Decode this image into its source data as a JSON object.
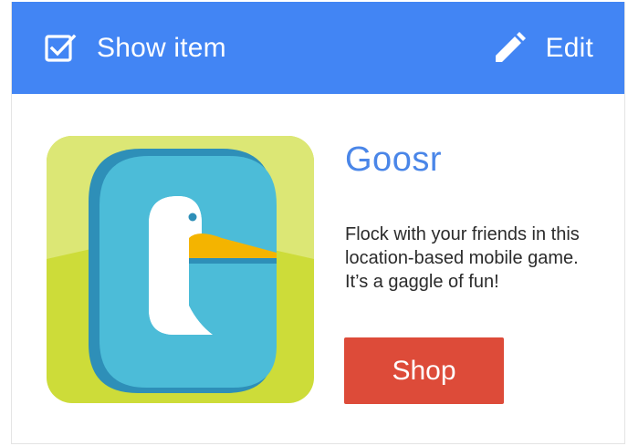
{
  "header": {
    "left_label": "Show item",
    "left_icon": "checkbox-icon",
    "right_label": "Edit",
    "right_icon": "pencil-icon"
  },
  "item": {
    "title": "Goosr",
    "description": "Flock with your friends in this location-based mobile game. It’s a gaggle of fun!",
    "button_label": "Shop",
    "icon": "goosr-app-icon"
  },
  "colors": {
    "accent": "#4285f4",
    "title": "#4a86e8",
    "button": "#dd4b39",
    "icon_bg": "#cddc39",
    "icon_letter": "#4cbcd8"
  }
}
